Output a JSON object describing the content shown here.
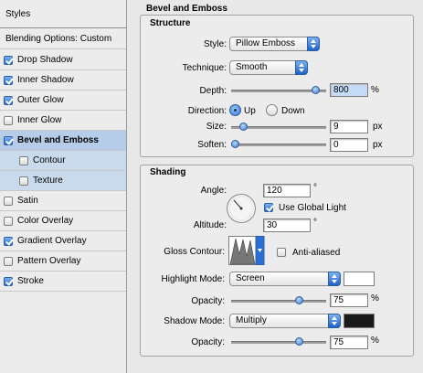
{
  "sidebar": {
    "title": "Styles",
    "blending": "Blending Options: Custom",
    "items": [
      {
        "label": "Drop Shadow",
        "checked": true
      },
      {
        "label": "Inner Shadow",
        "checked": true
      },
      {
        "label": "Outer Glow",
        "checked": true
      },
      {
        "label": "Inner Glow",
        "checked": false
      },
      {
        "label": "Bevel and Emboss",
        "checked": true,
        "selected": true
      },
      {
        "label": "Contour",
        "checked": false
      },
      {
        "label": "Texture",
        "checked": false
      },
      {
        "label": "Satin",
        "checked": false
      },
      {
        "label": "Color Overlay",
        "checked": false
      },
      {
        "label": "Gradient Overlay",
        "checked": true
      },
      {
        "label": "Pattern Overlay",
        "checked": false
      },
      {
        "label": "Stroke",
        "checked": true
      }
    ]
  },
  "panel": {
    "title": "Bevel and Emboss",
    "structure": {
      "title": "Structure",
      "style_label": "Style:",
      "style_value": "Pillow Emboss",
      "technique_label": "Technique:",
      "technique_value": "Smooth",
      "depth_label": "Depth:",
      "depth_value": "800",
      "depth_unit": "%",
      "depth_slider": 0.95,
      "direction_label": "Direction:",
      "direction_up": "Up",
      "direction_down": "Down",
      "direction_selected": "Up",
      "size_label": "Size:",
      "size_value": "9",
      "size_unit": "px",
      "size_slider": 0.1,
      "soften_label": "Soften:",
      "soften_value": "0",
      "soften_unit": "px",
      "soften_slider": 0.0
    },
    "shading": {
      "title": "Shading",
      "angle_label": "Angle:",
      "angle_value": "120",
      "angle_unit": "°",
      "use_global_light": "Use Global Light",
      "use_global_light_checked": true,
      "altitude_label": "Altitude:",
      "altitude_value": "30",
      "altitude_unit": "°",
      "gloss_contour_label": "Gloss Contour:",
      "anti_aliased": "Anti-aliased",
      "anti_aliased_checked": false,
      "highlight_mode_label": "Highlight Mode:",
      "highlight_mode_value": "Screen",
      "highlight_color": "#ffffff",
      "highlight_opacity_label": "Opacity:",
      "highlight_opacity_value": "75",
      "highlight_opacity_unit": "%",
      "highlight_opacity_slider": 0.75,
      "shadow_mode_label": "Shadow Mode:",
      "shadow_mode_value": "Multiply",
      "shadow_color": "#1a1a1a",
      "shadow_opacity_label": "Opacity:",
      "shadow_opacity_value": "75",
      "shadow_opacity_unit": "%",
      "shadow_opacity_slider": 0.75
    }
  }
}
